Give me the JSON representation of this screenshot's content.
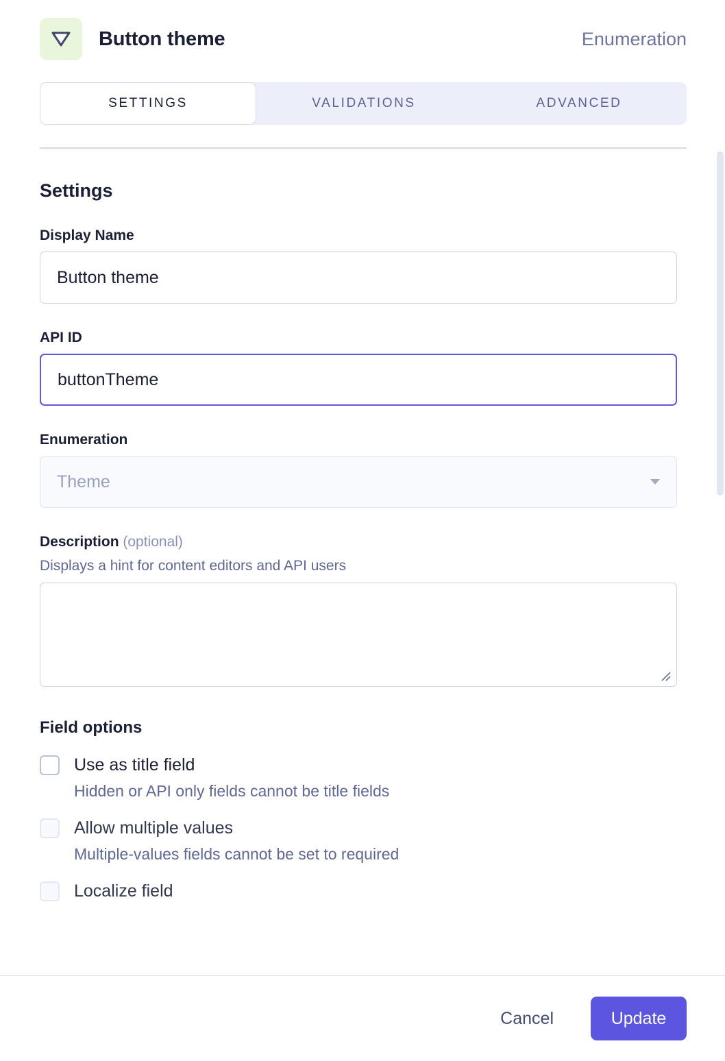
{
  "header": {
    "icon": "enumeration-triangle-icon",
    "icon_bg": "#e9f6dc",
    "title": "Button theme",
    "type_label": "Enumeration"
  },
  "tabs": [
    {
      "label": "Settings",
      "active": true
    },
    {
      "label": "Validations",
      "active": false
    },
    {
      "label": "Advanced",
      "active": false
    }
  ],
  "main": {
    "section_title": "Settings",
    "display_name": {
      "label": "Display Name",
      "value": "Button theme",
      "placeholder": ""
    },
    "api_id": {
      "label": "API ID",
      "value": "buttonTheme",
      "placeholder": "",
      "focused": true,
      "focus_color": "#6058d9"
    },
    "enumeration": {
      "label": "Enumeration",
      "value": "Theme",
      "caret_icon": "chevron-down-icon"
    },
    "description": {
      "label": "Description",
      "optional_suffix": "(optional)",
      "hint": "Displays a hint for content editors and API users",
      "value": "",
      "placeholder": ""
    },
    "field_options": {
      "title": "Field options",
      "items": [
        {
          "label": "Use as title field",
          "description": "Hidden or API only fields cannot be title fields",
          "checked": false,
          "disabled": false
        },
        {
          "label": "Allow multiple values",
          "description": "Multiple-values fields cannot be set to required",
          "checked": false,
          "disabled": true
        },
        {
          "label": "Localize field",
          "description": "",
          "checked": false,
          "disabled": true
        }
      ]
    }
  },
  "scrollbar": {
    "thumb_color": "#e2e6f3"
  },
  "footer": {
    "cancel_label": "Cancel",
    "update_label": "Update",
    "update_color": "#5b55e0"
  }
}
